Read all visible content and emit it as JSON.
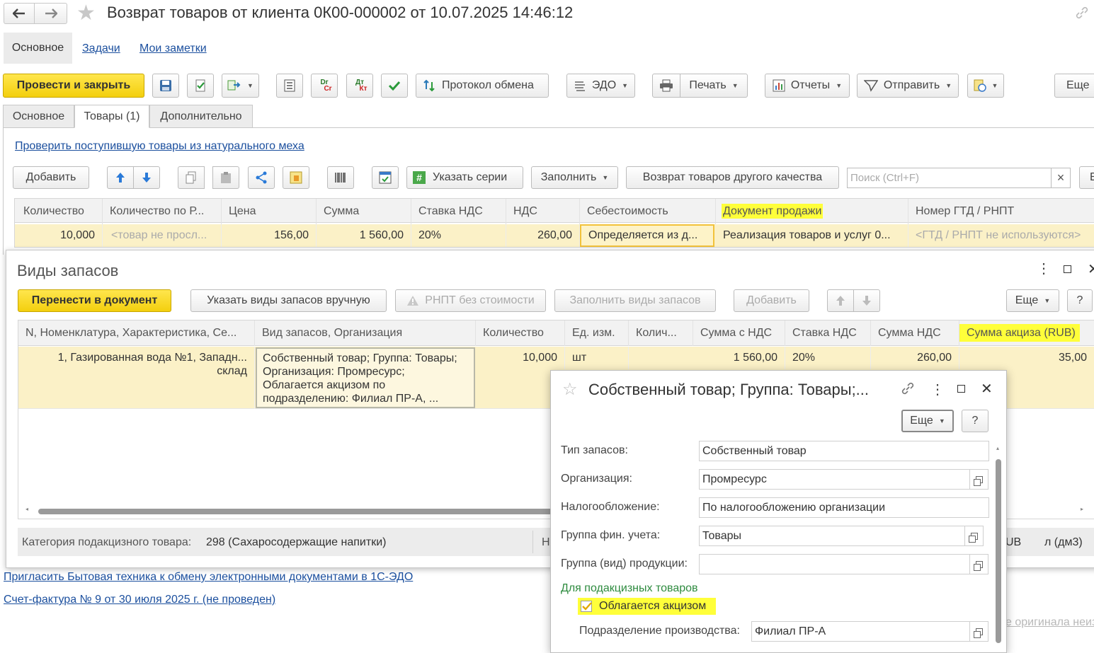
{
  "window": {
    "title": "Возврат товаров от клиента 0К00-000002 от 10.07.2025 14:46:12",
    "nav": [
      "Основное",
      "Задачи",
      "Мои заметки"
    ]
  },
  "toolbar": {
    "post_close": "Провести и закрыть",
    "exchange_log": "Протокол обмена",
    "edo": "ЭДО",
    "print": "Печать",
    "reports": "Отчеты",
    "send": "Отправить",
    "more": "Еще",
    "dr_cr": "Dr",
    "dr_cr2": "Cr",
    "dt_kt": "Дт",
    "dt_kt2": "Кт"
  },
  "tabs": [
    "Основное",
    "Товары (1)",
    "Дополнительно"
  ],
  "check_link": "Проверить поступившую товары из натурального меха",
  "goods_toolbar": {
    "add": "Добавить",
    "specify_series": "Указать серии",
    "fill": "Заполнить",
    "return_other": "Возврат товаров другого качества",
    "search_placeholder": "Поиск (Ctrl+F)",
    "clear": "×",
    "more_trunc": "Е"
  },
  "goods_table": {
    "headers": [
      "Количество",
      "Количество по Р...",
      "Цена",
      "Сумма",
      "Ставка НДС",
      "НДС",
      "Себестоимость",
      "Документ продажи",
      "Номер ГТД / РНПТ"
    ],
    "row": [
      "10,000",
      "<товар не просл...",
      "156,00",
      "1 560,00",
      "20%",
      "260,00",
      "Определяется из д...",
      "Реализация товаров и услуг 0...",
      "<ГТД / РНПТ не используются>"
    ]
  },
  "stock_dialog": {
    "title": "Виды запасов",
    "transfer": "Перенести в документ",
    "specify_manual": "Указать виды запасов вручную",
    "rnpt_no_cost": "РНПТ без стоимости",
    "fill_types": "Заполнить виды запасов",
    "add": "Добавить",
    "more": "Еще",
    "help": "?",
    "headers": [
      "N, Номенклатура, Характеристика, Се...",
      "Вид запасов, Организация",
      "Количество",
      "Ед. изм.",
      "Колич...",
      "Сумма с НДС",
      "Ставка НДС",
      "Сумма НДС",
      "Сумма акциза (RUB)"
    ],
    "row": {
      "item_line1": "1, Газированная вода №1, Западн...",
      "item_line2": "склад",
      "stock_lines": [
        "Собственный товар; Группа: Товары;",
        "Организация: Промресурс;",
        "Облагается акцизом по",
        "подразделению: Филиал ПР-А, ..."
      ],
      "qty": "10,000",
      "unit": "шт",
      "sum_vat": "1 560,00",
      "vat_rate": "20%",
      "vat_sum": "260,00",
      "excise": "35,00"
    },
    "footer_category_label": "Категория подакцизного товара:",
    "footer_category_value": "298 (Сахаросодержащие напитки)",
    "footer_frag_left": "Н",
    "footer_frag_rub": "UB",
    "footer_frag_unit": "л (дм3)"
  },
  "links": {
    "invite": "Пригласить Бытовая техника  к обмену электронными документами в 1С-ЭДО",
    "invoice": "Счет-фактура № 9 от 30 июля 2025 г. (не проведен)",
    "original_frag": "е оригинала неиз"
  },
  "stock_form": {
    "title": "Собственный товар; Группа: Товары;...",
    "more": "Еще",
    "help": "?",
    "fields": [
      {
        "label": "Тип запасов:",
        "value": "Собственный товар"
      },
      {
        "label": "Организация:",
        "value": "Промресурс"
      },
      {
        "label": "Налогообложение:",
        "value": "По налогообложению организации"
      },
      {
        "label": "Группа фин. учета:",
        "value": "Товары"
      },
      {
        "label": "Группа (вид) продукции:",
        "value": ""
      }
    ],
    "excise_section": "Для подакцизных товаров",
    "excise_checkbox": "Облагается акцизом",
    "division_label": "Подразделение производства:",
    "division_value": "Филиал ПР-А"
  },
  "colors": {
    "accent_yellow": "#f8dc2a",
    "link_blue": "#1b4f9e",
    "highlight": "#ffff3a",
    "section_green": "#2e8b3f"
  }
}
